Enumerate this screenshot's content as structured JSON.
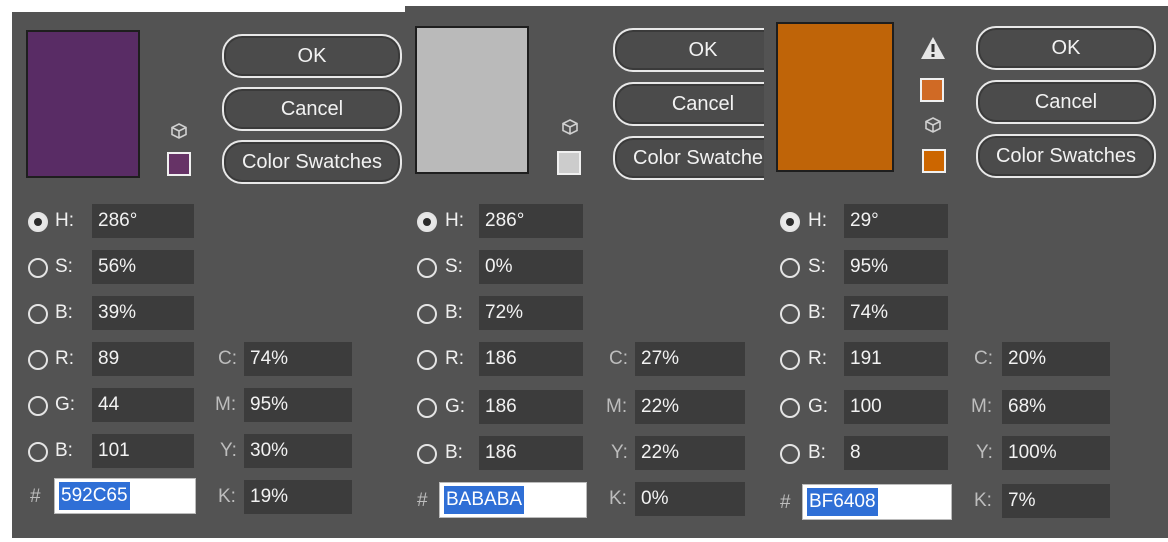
{
  "buttons": {
    "ok": "OK",
    "cancel": "Cancel",
    "swatches": "Color Swatches",
    "swatches_cut": "Color Swatche"
  },
  "labels": {
    "h": "H:",
    "s": "S:",
    "b": "B:",
    "r": "R:",
    "g": "G:",
    "b2": "B:",
    "c": "C:",
    "m": "M:",
    "y": "Y:",
    "k": "K:",
    "hash": "#"
  },
  "pickers": [
    {
      "color": "#592C65",
      "web_safe_color": "#663366",
      "h": "286°",
      "s": "56%",
      "b": "39%",
      "r": "89",
      "g": "44",
      "b_val": "101",
      "c": "74%",
      "m": "95%",
      "y": "30%",
      "k": "19%",
      "hex": "592C65",
      "selected": "H"
    },
    {
      "color": "#BABABA",
      "web_safe_color": "#CCCCCC",
      "h": "286°",
      "s": "0%",
      "b": "72%",
      "r": "186",
      "g": "186",
      "b_val": "186",
      "c": "27%",
      "m": "22%",
      "y": "22%",
      "k": "0%",
      "hex": "BABABA",
      "selected": "H"
    },
    {
      "color": "#BF6408",
      "gamut_warning_color": "#D06A25",
      "web_safe_color": "#CC6600",
      "h": "29°",
      "s": "95%",
      "b": "74%",
      "r": "191",
      "g": "100",
      "b_val": "8",
      "c": "20%",
      "m": "68%",
      "y": "100%",
      "k": "7%",
      "hex": "BF6408",
      "selected": "H"
    }
  ],
  "icons": {
    "cube": "web-safe-cube-icon",
    "warning": "out-of-gamut-warning-icon",
    "radio": "radio-button-icon"
  }
}
